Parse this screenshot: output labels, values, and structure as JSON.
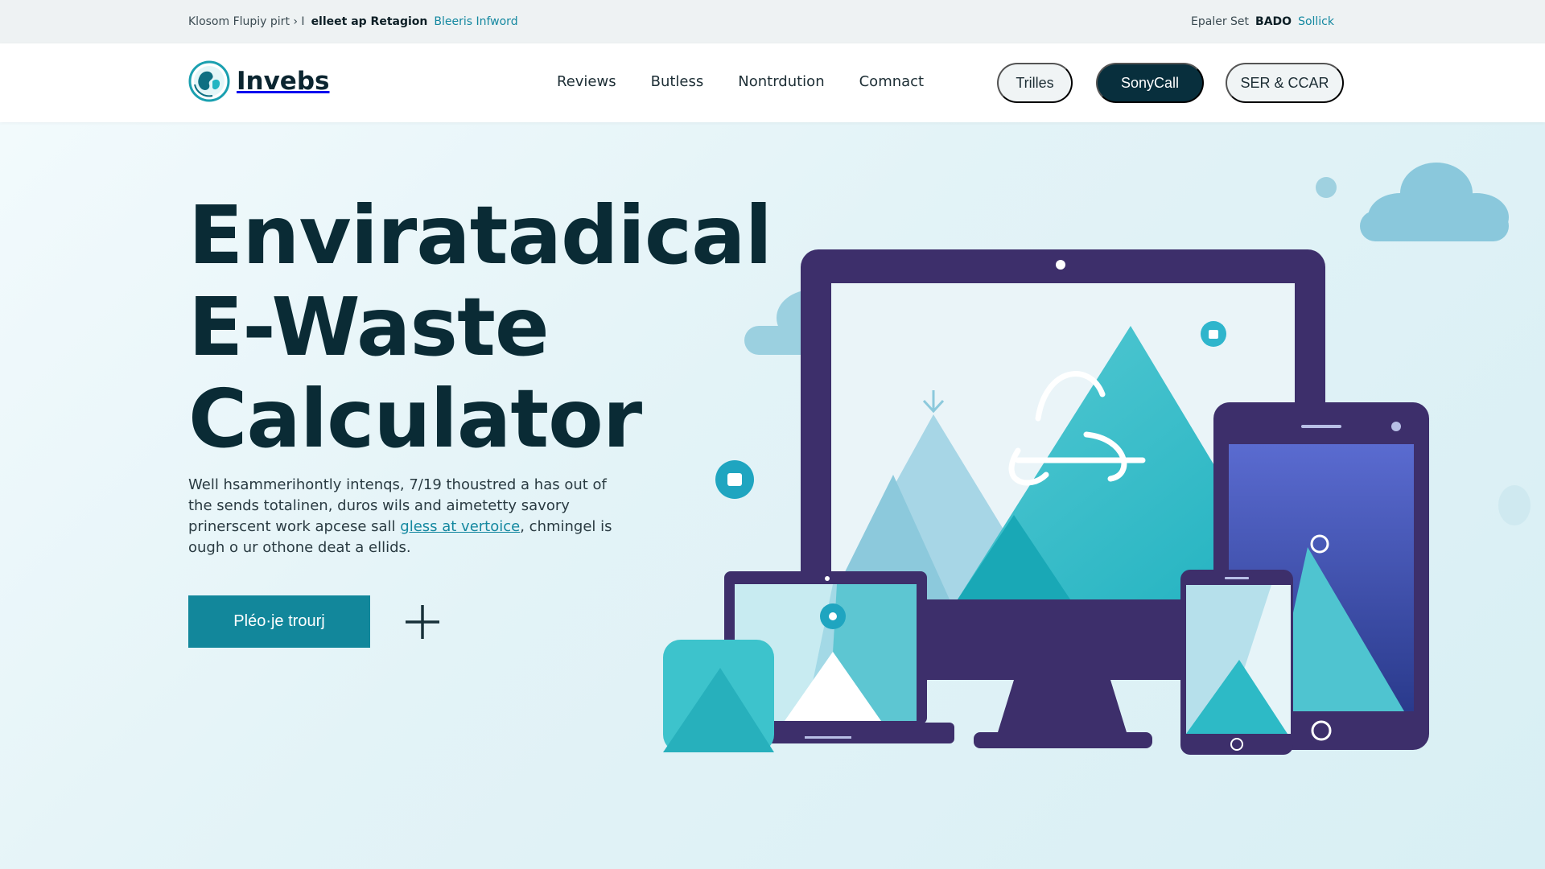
{
  "utility": {
    "left_muted": "Klosom Flupiy pirt › I",
    "left_strong": "elleet ap Retagion",
    "left_link": "Bleeris Infword",
    "right_muted": "Epaler Set",
    "right_strong": "BADO",
    "right_link": "Sollick"
  },
  "brand": {
    "name": "Invebs"
  },
  "nav": {
    "items": [
      "Reviews",
      "Butless",
      "Nontrdution",
      "Comnact"
    ]
  },
  "header_actions": {
    "ghost_label": "Trilles",
    "primary_label": "SonyCall",
    "secondary_label": "SER & CCAR"
  },
  "hero": {
    "title_lines": [
      "Enviratadical",
      "E-Waste",
      "Calculator"
    ],
    "desc_before_link": "Well hsammerihontly intenqs, 7/19 thoustred a has out of the sends totalinen, duros wils and aimetetty savory prinerscent work apcese sall ",
    "desc_link": "gless at vertoice",
    "desc_after_link": ", chmingel is ough o ur othone deat a ellids.",
    "cta_label": "Pléo·je trourj"
  },
  "colors": {
    "dark_navy": "#082f3d",
    "teal": "#12879b",
    "link": "#1488a0",
    "device_purple": "#3d2f6b",
    "mountain_teal": "#2bc0cc"
  },
  "icons": {
    "logo": "globe-leaf-icon",
    "plus": "plus-icon",
    "recycle": "recycle-icon",
    "bag": "shopping-bag-icon"
  }
}
